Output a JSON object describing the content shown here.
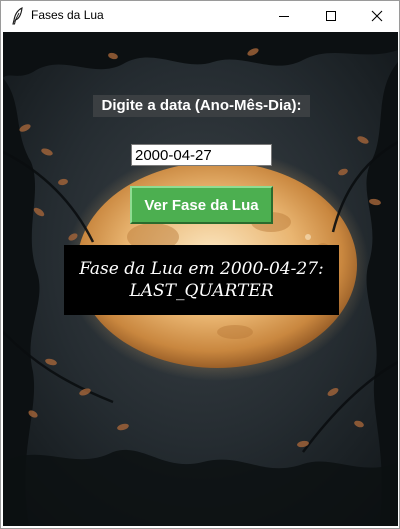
{
  "window": {
    "title": "Fases da Lua",
    "app_icon": "feather-icon",
    "controls": {
      "minimize": "minimize-icon",
      "maximize": "maximize-icon",
      "close": "close-icon"
    }
  },
  "form": {
    "prompt_label": "Digite a data (Ano-Mês-Dia):",
    "date_value": "2000-04-27",
    "button_label": "Ver Fase da Lua",
    "button_color": "#4caf50"
  },
  "result": {
    "line1": "Fase da Lua em 2000-04-27:",
    "line2": "LAST_QUARTER"
  }
}
